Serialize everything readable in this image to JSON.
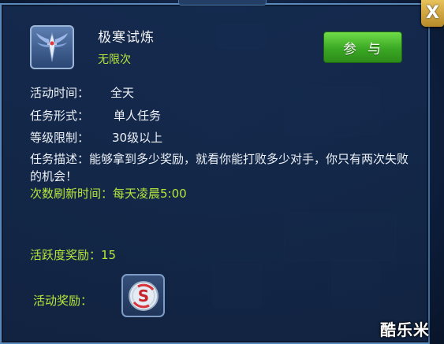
{
  "dialog": {
    "title": "极寒试炼",
    "subtitle": "无限次",
    "join_label": "参与",
    "close_label": "X"
  },
  "info": {
    "time_label": "活动时间：",
    "time_value": "全天",
    "form_label": "任务形式：",
    "form_value": "单人任务",
    "level_label": "等级限制：",
    "level_value": "30级以上",
    "description": "任务描述：能够拿到多少奖励，就看你能打败多少对手，你只有两次失败的机会！",
    "refresh": "次数刷新时间：每天凌晨5:00",
    "activity_reward": "活跃度奖励：15",
    "reward_label": "活动奖励："
  },
  "icons": {
    "badge": "winged-sword-badge-icon",
    "reward": "silver-coin-icon",
    "close": "close-icon"
  },
  "watermark": "酷乐米",
  "colors": {
    "accent_green": "#b7e83b",
    "button_green": "#3aa824",
    "panel_bg": "#142a4e",
    "close_gold": "#d6a843"
  }
}
